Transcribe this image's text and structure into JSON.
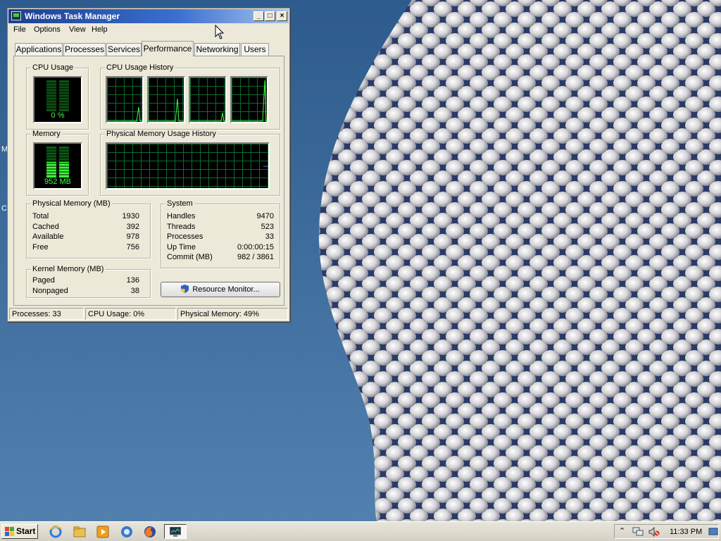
{
  "window": {
    "title": "Windows Task Manager",
    "controls": {
      "minimize": "_",
      "maximize": "□",
      "close": "×"
    }
  },
  "menu": [
    "File",
    "Options",
    "View",
    "Help"
  ],
  "tabs": [
    "Applications",
    "Processes",
    "Services",
    "Performance",
    "Networking",
    "Users"
  ],
  "active_tab": "Performance",
  "performance": {
    "cpu_usage": {
      "label": "CPU Usage",
      "value": "0 %",
      "percent": 0
    },
    "cpu_history": {
      "label": "CPU Usage History"
    },
    "memory": {
      "label": "Memory",
      "value": "952 MB",
      "fraction": 0.49
    },
    "memory_history": {
      "label": "Physical Memory Usage History"
    },
    "physical_memory": {
      "label": "Physical Memory (MB)",
      "rows": [
        {
          "label": "Total",
          "value": "1930"
        },
        {
          "label": "Cached",
          "value": "392"
        },
        {
          "label": "Available",
          "value": "978"
        },
        {
          "label": "Free",
          "value": "756"
        }
      ]
    },
    "kernel_memory": {
      "label": "Kernel Memory (MB)",
      "rows": [
        {
          "label": "Paged",
          "value": "136"
        },
        {
          "label": "Nonpaged",
          "value": "38"
        }
      ]
    },
    "system": {
      "label": "System",
      "rows": [
        {
          "label": "Handles",
          "value": "9470"
        },
        {
          "label": "Threads",
          "value": "523"
        },
        {
          "label": "Processes",
          "value": "33"
        },
        {
          "label": "Up Time",
          "value": "0:00:00:15"
        },
        {
          "label": "Commit (MB)",
          "value": "982 / 3861"
        }
      ]
    },
    "resource_monitor_button": "Resource Monitor..."
  },
  "status_bar": {
    "processes": "Processes: 33",
    "cpu": "CPU Usage: 0%",
    "memory": "Physical Memory: 49%"
  },
  "taskbar": {
    "start_label": "Start",
    "clock": "11:33 PM",
    "tray_expand": "⌃"
  },
  "desktop": {
    "glyph_1": "M",
    "glyph_2": "C"
  },
  "colors": {
    "graph_line": "#3cff3c",
    "graph_grid": "#0f6a2d",
    "titlebar": "#1d3f8e",
    "desktop": "#3e6c9c"
  }
}
